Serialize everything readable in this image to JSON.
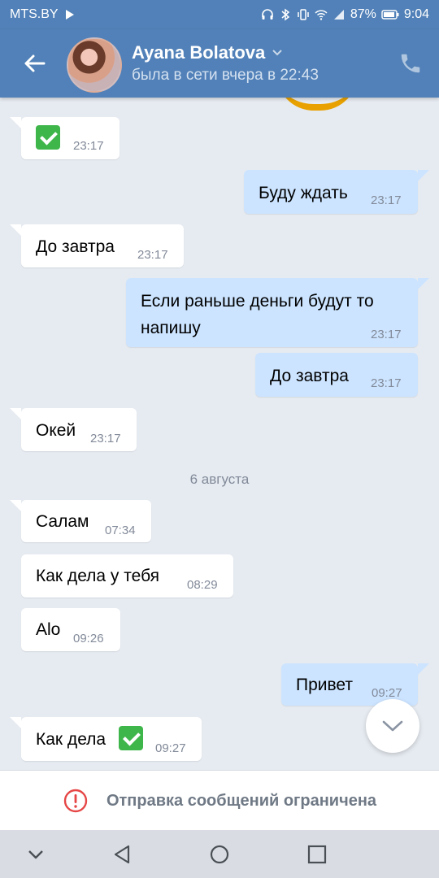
{
  "status_bar": {
    "carrier": "MTS.BY",
    "battery": "87%",
    "time": "9:04"
  },
  "header": {
    "name": "Ayana Bolatova",
    "last_seen": "была в сети вчера в 22:43"
  },
  "messages": [
    {
      "dir": "in",
      "text": "",
      "emoji": "check-mark",
      "time": "23:17"
    },
    {
      "dir": "out",
      "text": "Буду ждать",
      "time": "23:17"
    },
    {
      "dir": "in",
      "text": "До завтра",
      "time": "23:17"
    },
    {
      "dir": "out",
      "text_line1": "Если раньше деньги будут то",
      "text_line2": "напишу",
      "time": "23:17"
    },
    {
      "dir": "out",
      "text": "До завтра",
      "time": "23:17"
    },
    {
      "dir": "in",
      "text": "Окей",
      "time": "23:17"
    },
    {
      "dir": "in",
      "text": "Салам",
      "time": "07:34"
    },
    {
      "dir": "in",
      "text": "Как дела у тебя",
      "time": "08:29"
    },
    {
      "dir": "in",
      "text": "Alo",
      "time": "09:26"
    },
    {
      "dir": "out",
      "text": "Привет",
      "time": "09:27"
    },
    {
      "dir": "in",
      "text": "Как дела",
      "emoji": "check-mark",
      "time": "09:27"
    }
  ],
  "date_separator": "6 августа",
  "restricted_notice": "Отправка сообщений ограничена",
  "colors": {
    "header": "#5181b8",
    "chat_bg": "#e6ebf1",
    "out_bubble": "#cce4ff",
    "in_bubble": "#ffffff",
    "alert": "#e64646"
  }
}
